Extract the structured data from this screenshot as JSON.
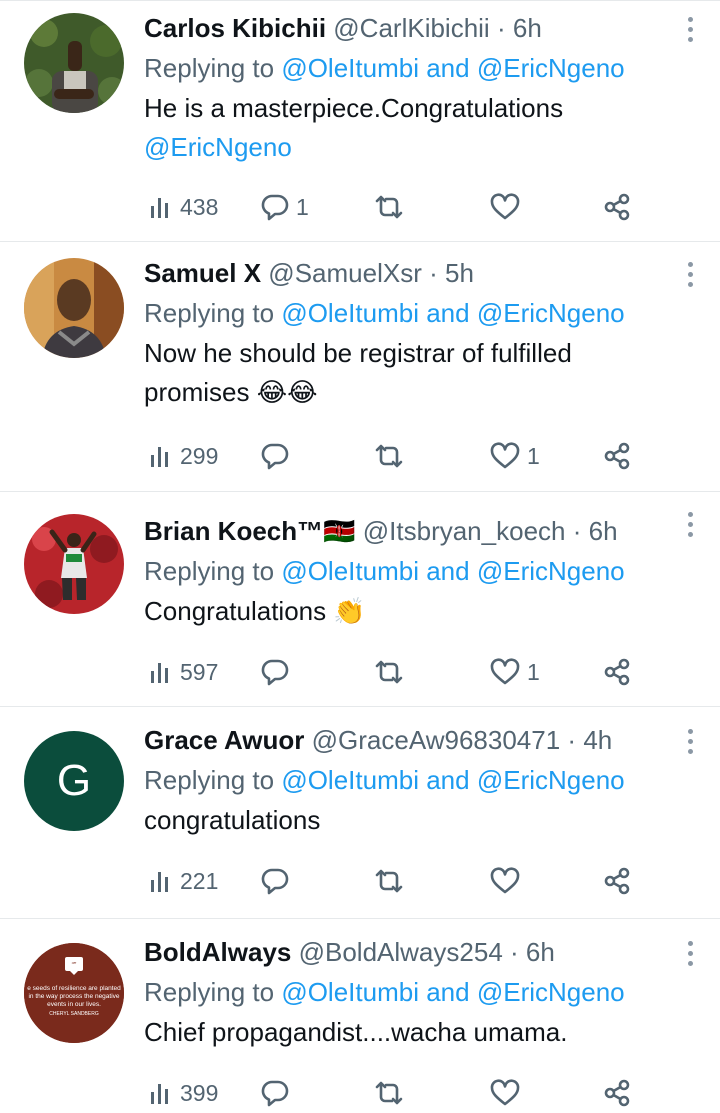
{
  "tweets": [
    {
      "name": "Carlos Kibichii",
      "handle": "@CarlKibichii",
      "dot": "·",
      "time": "6h",
      "replying_prefix": "Replying to",
      "reply_to_1": "@OleItumbi",
      "reply_and": "and",
      "reply_to_2": "@EricNgeno",
      "text_line1": "He is a masterpiece.Congratulations",
      "text_line2_mention": "@EricNgeno",
      "views": "438",
      "replies": "1",
      "retweets": "",
      "likes": ""
    },
    {
      "name": "Samuel X",
      "handle": "@SamuelXsr",
      "dot": "·",
      "time": "5h",
      "replying_prefix": "Replying to",
      "reply_to_1": "@OleItumbi",
      "reply_and": "and",
      "reply_to_2": "@EricNgeno",
      "text_line1": "Now he should be registrar of fulfilled",
      "text_line2": "promises",
      "text_emoji": "😂😂",
      "views": "299",
      "replies": "",
      "retweets": "",
      "likes": "1"
    },
    {
      "name": "Brian Koech™",
      "name_flag": "🇰🇪",
      "handle": "@Itsbryan_koech",
      "dot": "·",
      "time": "6h",
      "replying_prefix": "Replying to",
      "reply_to_1": "@OleItumbi",
      "reply_and": "and",
      "reply_to_2": "@EricNgeno",
      "text_line1": "Congratulations",
      "text_emoji": "👏",
      "views": "597",
      "replies": "",
      "retweets": "",
      "likes": "1"
    },
    {
      "name": "Grace Awuor",
      "handle": "@GraceAw96830471",
      "dot": "·",
      "time": "4h",
      "avatar_letter": "G",
      "replying_prefix": "Replying to",
      "reply_to_1": "@OleItumbi",
      "reply_and": "and",
      "reply_to_2": "@EricNgeno",
      "text_line1": "congratulations",
      "views": "221",
      "replies": "",
      "retweets": "",
      "likes": ""
    },
    {
      "name": "BoldAlways",
      "handle": "@BoldAlways254",
      "dot": "·",
      "time": "6h",
      "avatar_text": "e seeds of resilience are planted in the way process the negative events in our lives.",
      "avatar_author": "CHERYL SANDBERG",
      "replying_prefix": "Replying to",
      "reply_to_1": "@OleItumbi",
      "reply_and": "and",
      "reply_to_2": "@EricNgeno",
      "text_line1": "Chief propagandist....wacha umama.",
      "views": "399",
      "replies": "",
      "retweets": "",
      "likes": ""
    }
  ],
  "colors": {
    "name": "#0f1419",
    "secondary": "#536471",
    "mention": "#1d9bf0",
    "divider": "#e6e9eb",
    "grace_avatar": "#0b4d3c",
    "bold_avatar": "#7a2a1c"
  },
  "icons": [
    "views-icon",
    "reply-icon",
    "retweet-icon",
    "like-icon",
    "share-icon",
    "more-icon"
  ]
}
